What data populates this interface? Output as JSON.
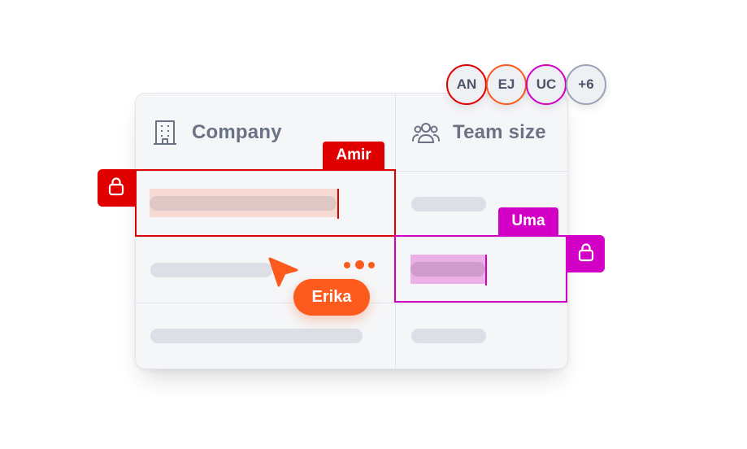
{
  "table": {
    "columns": [
      {
        "label": "Company",
        "icon": "building-icon"
      },
      {
        "label": "Team size",
        "icon": "team-icon"
      }
    ]
  },
  "collaborators": {
    "avatars": [
      {
        "initials": "AN",
        "color": "#e00000"
      },
      {
        "initials": "EJ",
        "color": "#fd5a1e"
      },
      {
        "initials": "UC",
        "color": "#d100c4"
      }
    ],
    "overflow": "+6",
    "overflow_color": "#9aa3b5"
  },
  "presence": {
    "amir": {
      "name": "Amir",
      "color": "#e00000",
      "status": "locked"
    },
    "uma": {
      "name": "Uma",
      "color": "#d100c4",
      "status": "locked"
    },
    "erika": {
      "name": "Erika",
      "color": "#fd5a1e",
      "status": "typing"
    }
  },
  "icons": {
    "lock": "lock-icon",
    "cursor": "arrow-cursor-icon",
    "typing": "typing-dots-icon"
  }
}
